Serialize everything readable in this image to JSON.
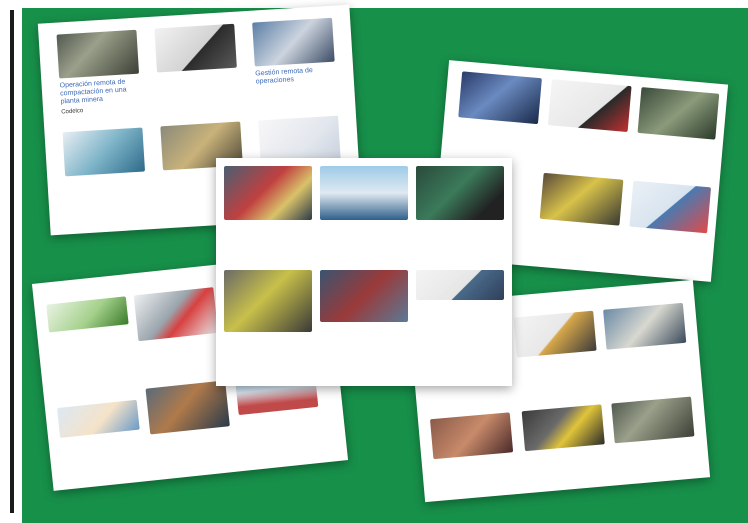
{
  "page": {
    "colors": {
      "background": "#17904a",
      "sheet": "#ffffff",
      "link": "#3d6ab8",
      "frame_bar": "#1b1b1b"
    }
  },
  "sheets": {
    "top_left": {
      "cards": [
        {
          "title": "Operación remota de compactación en una planta minera",
          "meta": "Codelco",
          "thumb": "a"
        },
        {
          "title": "",
          "meta": "",
          "thumb": "b"
        },
        {
          "title": "Gestión remota de operaciones",
          "meta": "",
          "thumb": "c"
        },
        {
          "title": "",
          "meta": "",
          "thumb": "d"
        },
        {
          "title": "",
          "meta": "",
          "thumb": "e"
        },
        {
          "title": "",
          "meta": "",
          "thumb": "f"
        }
      ]
    },
    "top_right": {
      "cards": [
        {
          "title": "",
          "meta": "",
          "thumb": "m"
        },
        {
          "title": "",
          "meta": "",
          "thumb": "n"
        },
        {
          "title": "",
          "meta": "",
          "thumb": "o"
        },
        {
          "title": "",
          "meta": "",
          "thumb": "p"
        },
        {
          "title": "",
          "meta": "",
          "thumb": "q"
        }
      ]
    },
    "center": {
      "cards": [
        {
          "title": "",
          "meta": "",
          "thumb": "g"
        },
        {
          "title": "",
          "meta": "",
          "thumb": "h"
        },
        {
          "title": "",
          "meta": "",
          "thumb": "i"
        },
        {
          "title": "",
          "meta": "",
          "thumb": "j"
        },
        {
          "title": "",
          "meta": "",
          "thumb": "k"
        },
        {
          "title": "",
          "meta": "",
          "thumb": "l"
        }
      ]
    },
    "bottom_left": {
      "heading": "",
      "cards": [
        {
          "title": "",
          "meta": "",
          "thumb": "r"
        },
        {
          "title": "",
          "meta": "",
          "thumb": "s"
        },
        {
          "title": "",
          "meta": "",
          "thumb": "t"
        },
        {
          "title": "",
          "meta": "",
          "thumb": "u"
        },
        {
          "title": "",
          "meta": "",
          "thumb": "v"
        }
      ]
    },
    "bottom_right": {
      "heading": "",
      "cards": [
        {
          "title": "",
          "meta": "",
          "thumb": "w"
        },
        {
          "title": "",
          "meta": "",
          "thumb": "x"
        },
        {
          "title": "",
          "meta": "",
          "thumb": "z"
        },
        {
          "title": "",
          "meta": "",
          "thumb": "y"
        },
        {
          "title": "",
          "meta": "",
          "thumb": "a"
        }
      ]
    }
  }
}
